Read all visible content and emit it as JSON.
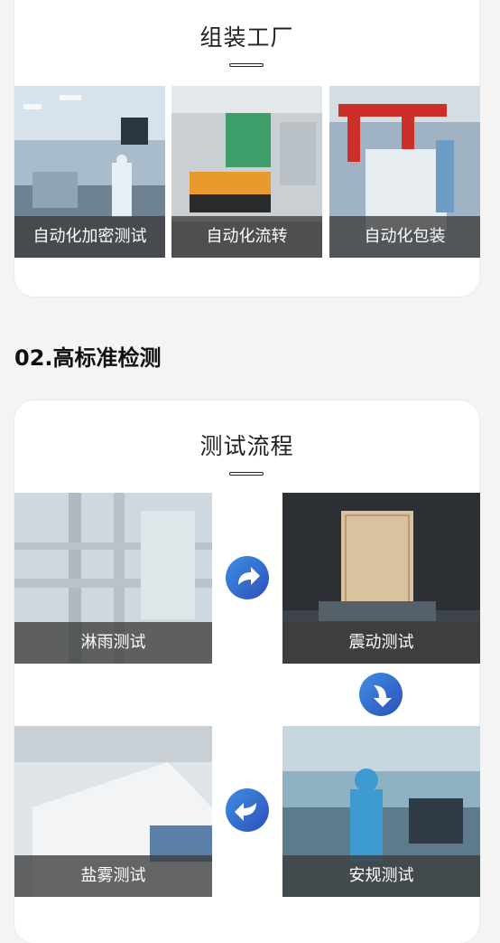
{
  "factory": {
    "title": "组装工厂",
    "photos": [
      {
        "caption": "自动化加密测试"
      },
      {
        "caption": "自动化流转"
      },
      {
        "caption": "自动化包装"
      }
    ]
  },
  "section": {
    "heading": "02.高标准检测"
  },
  "test": {
    "title": "测试流程",
    "steps": [
      {
        "caption": "淋雨测试"
      },
      {
        "caption": "震动测试"
      },
      {
        "caption": "盐雾测试"
      },
      {
        "caption": "安规测试"
      }
    ]
  },
  "icons": {
    "arrow_right": "arrow-right-icon",
    "arrow_down": "arrow-down-icon",
    "arrow_left": "arrow-left-icon"
  },
  "colors": {
    "arrow_start": "#3f8fe6",
    "arrow_end": "#2d4fb8"
  }
}
